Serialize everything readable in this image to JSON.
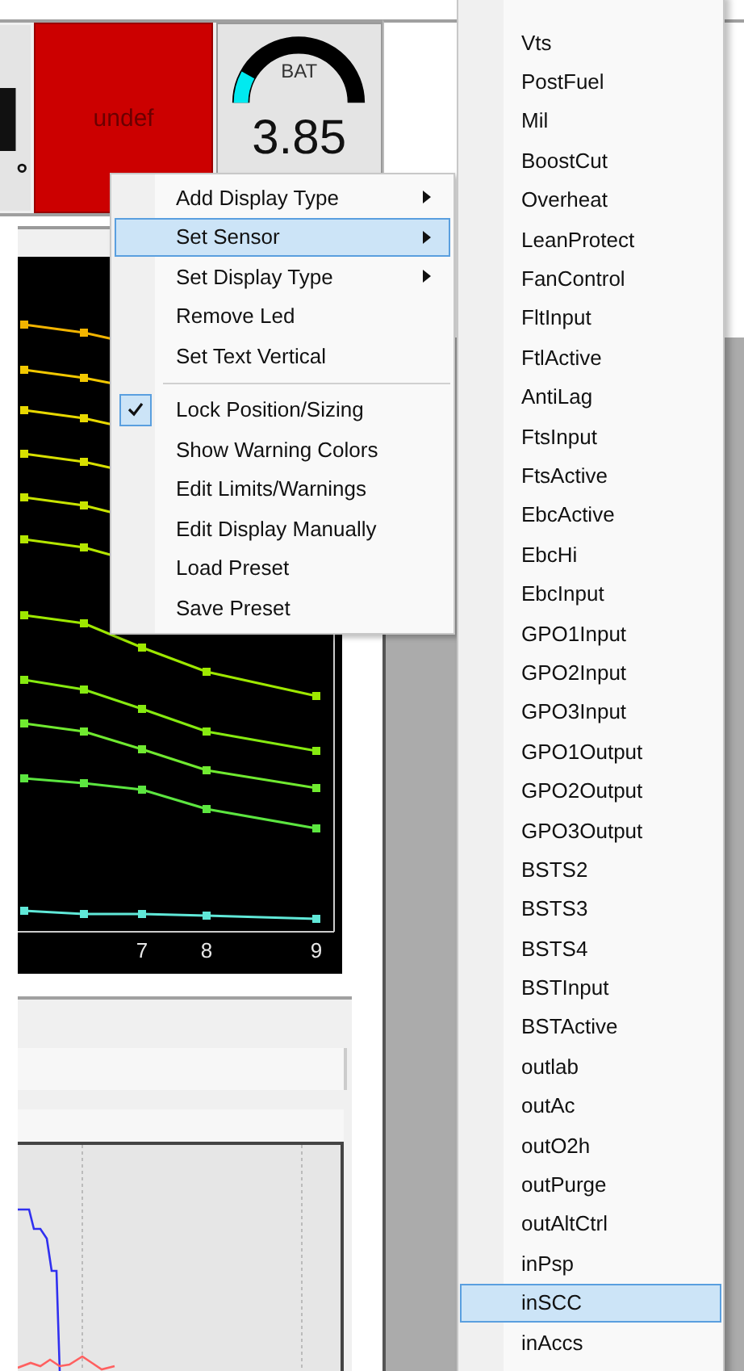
{
  "gauge_strip": {
    "status_box": {
      "text": "undef"
    },
    "gauge": {
      "label": "BAT",
      "value": "3.85",
      "level": 0.16
    }
  },
  "chart": {
    "x_labels": [
      "7",
      "8",
      "9"
    ]
  },
  "context_menu": {
    "items": [
      {
        "kind": "item",
        "label": "Add Display Type",
        "submenu": true,
        "selected": false,
        "checked": false
      },
      {
        "kind": "item",
        "label": "Set Sensor",
        "submenu": true,
        "selected": true,
        "checked": false
      },
      {
        "kind": "item",
        "label": "Set Display Type",
        "submenu": true,
        "selected": false,
        "checked": false
      },
      {
        "kind": "item",
        "label": "Remove Led",
        "submenu": false,
        "selected": false,
        "checked": false
      },
      {
        "kind": "item",
        "label": "Set Text Vertical",
        "submenu": false,
        "selected": false,
        "checked": false
      },
      {
        "kind": "separator"
      },
      {
        "kind": "item",
        "label": "Lock Position/Sizing",
        "submenu": false,
        "selected": false,
        "checked": true
      },
      {
        "kind": "item",
        "label": "Show Warning Colors",
        "submenu": false,
        "selected": false,
        "checked": false
      },
      {
        "kind": "item",
        "label": "Edit Limits/Warnings",
        "submenu": false,
        "selected": false,
        "checked": false
      },
      {
        "kind": "item",
        "label": "Edit Display Manually",
        "submenu": false,
        "selected": false,
        "checked": false
      },
      {
        "kind": "item",
        "label": "Load Preset",
        "submenu": false,
        "selected": false,
        "checked": false
      },
      {
        "kind": "item",
        "label": "Save Preset",
        "submenu": false,
        "selected": false,
        "checked": false
      }
    ]
  },
  "sensor_menu": {
    "items": [
      {
        "label": "Vts",
        "selected": false
      },
      {
        "label": "PostFuel",
        "selected": false
      },
      {
        "label": "Mil",
        "selected": false
      },
      {
        "label": "BoostCut",
        "selected": false
      },
      {
        "label": "Overheat",
        "selected": false
      },
      {
        "label": "LeanProtect",
        "selected": false
      },
      {
        "label": "FanControl",
        "selected": false
      },
      {
        "label": "FltInput",
        "selected": false
      },
      {
        "label": "FtlActive",
        "selected": false
      },
      {
        "label": "AntiLag",
        "selected": false
      },
      {
        "label": "FtsInput",
        "selected": false
      },
      {
        "label": "FtsActive",
        "selected": false
      },
      {
        "label": "EbcActive",
        "selected": false
      },
      {
        "label": "EbcHi",
        "selected": false
      },
      {
        "label": "EbcInput",
        "selected": false
      },
      {
        "label": "GPO1Input",
        "selected": false
      },
      {
        "label": "GPO2Input",
        "selected": false
      },
      {
        "label": "GPO3Input",
        "selected": false
      },
      {
        "label": "GPO1Output",
        "selected": false
      },
      {
        "label": "GPO2Output",
        "selected": false
      },
      {
        "label": "GPO3Output",
        "selected": false
      },
      {
        "label": "BSTS2",
        "selected": false
      },
      {
        "label": "BSTS3",
        "selected": false
      },
      {
        "label": "BSTS4",
        "selected": false
      },
      {
        "label": "BSTInput",
        "selected": false
      },
      {
        "label": "BSTActive",
        "selected": false
      },
      {
        "label": "outlab",
        "selected": false
      },
      {
        "label": "outAc",
        "selected": false
      },
      {
        "label": "outO2h",
        "selected": false
      },
      {
        "label": "outPurge",
        "selected": false
      },
      {
        "label": "outAltCtrl",
        "selected": false
      },
      {
        "label": "inPsp",
        "selected": false
      },
      {
        "label": "inSCC",
        "selected": true
      },
      {
        "label": "inAccs",
        "selected": false
      }
    ]
  }
}
